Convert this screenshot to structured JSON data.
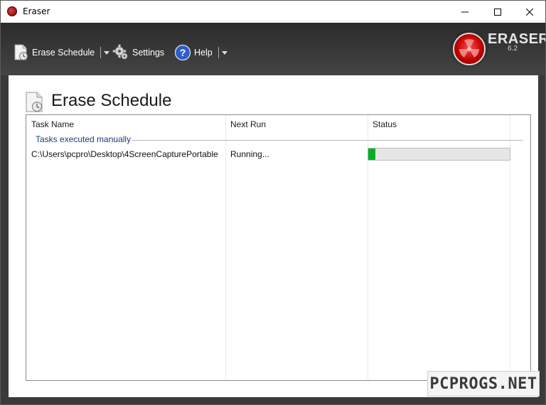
{
  "window": {
    "title": "Eraser"
  },
  "toolbar": {
    "erase_schedule_label": "Erase Schedule",
    "settings_label": "Settings",
    "help_label": "Help"
  },
  "logo": {
    "name": "ERASER",
    "version": "6.2"
  },
  "page": {
    "title": "Erase Schedule"
  },
  "table": {
    "columns": [
      "Task Name",
      "Next Run",
      "Status"
    ],
    "group": "Tasks executed manually",
    "rows": [
      {
        "task_name": "C:\\Users\\pcpro\\Desktop\\4ScreenCapturePortable",
        "next_run": "Running...",
        "progress": 0.05
      }
    ]
  },
  "watermark": "PCPROGS.NET",
  "colors": {
    "toolbar_bg": "#333333",
    "progress_fill": "#06b025",
    "group_label": "#1e3a78",
    "brand_red": "#c20000"
  },
  "icons": {
    "app": "eraser-logo-icon",
    "schedule": "schedule-document-icon",
    "settings": "gear-icon",
    "help": "help-question-icon"
  }
}
